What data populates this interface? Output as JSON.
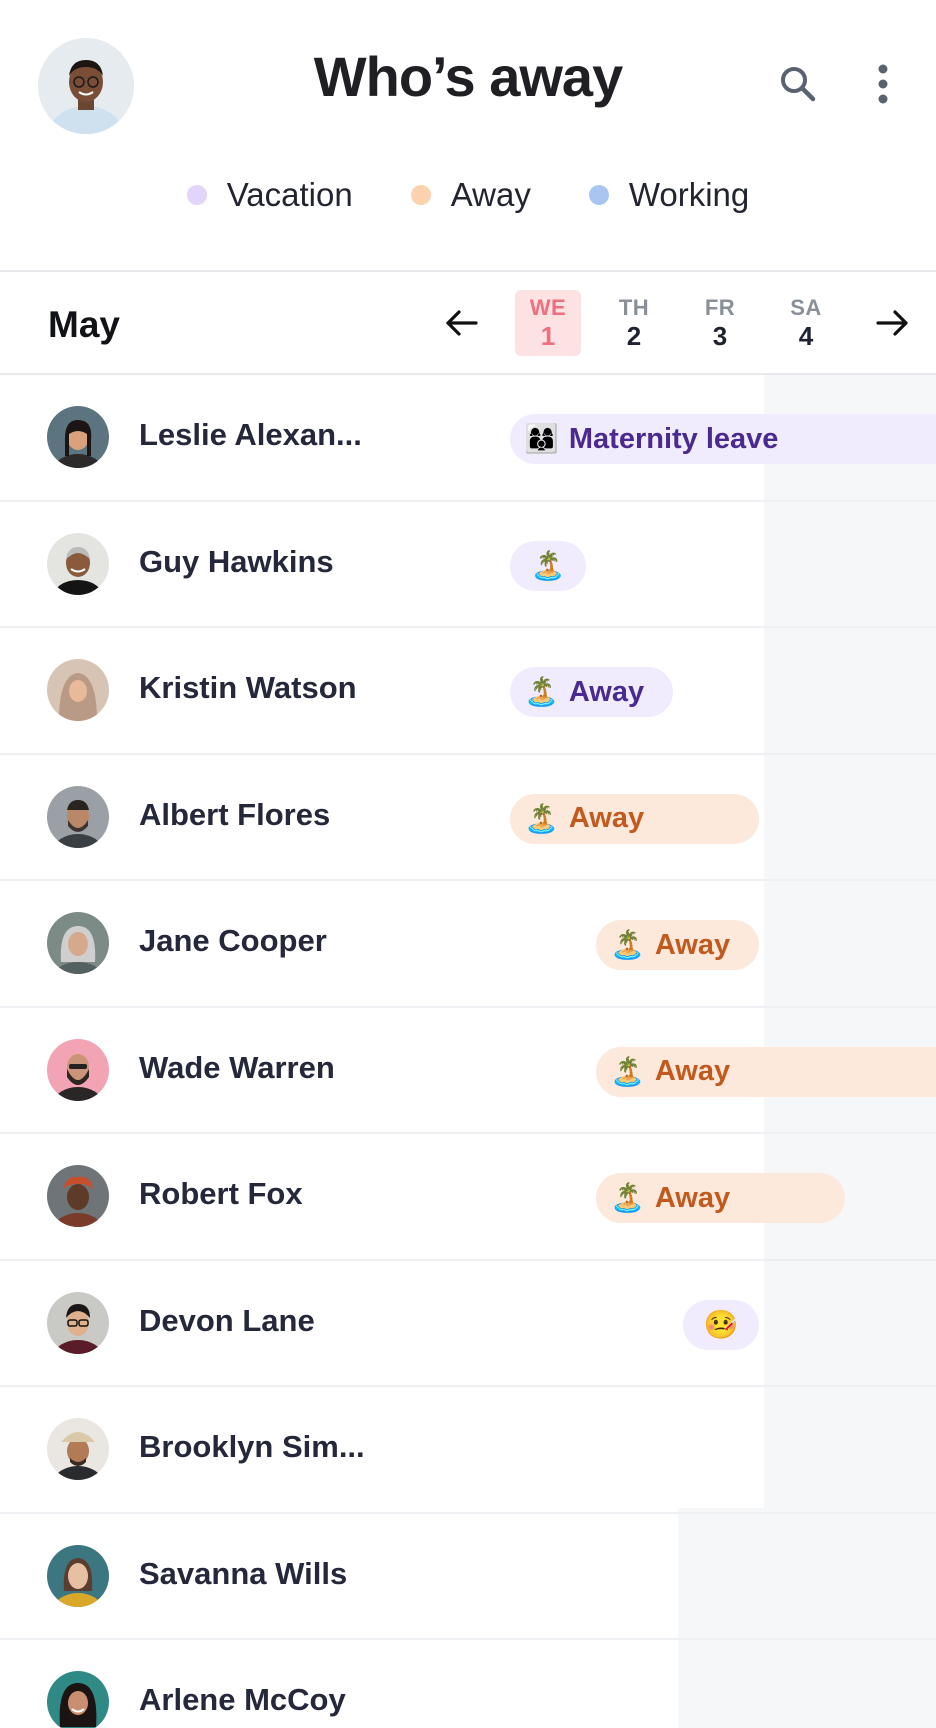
{
  "header": {
    "title": "Who’s away",
    "profile_avatar_icon": "profile-photo",
    "search_icon": "search-icon",
    "more_icon": "more-vertical-icon"
  },
  "legend": [
    {
      "label": "Vacation",
      "color": "#e3d4fb"
    },
    {
      "label": "Away",
      "color": "#fbd2ae"
    },
    {
      "label": "Working",
      "color": "#a9c6f3"
    }
  ],
  "calendar": {
    "month": "May",
    "prev_icon": "arrow-left-icon",
    "next_icon": "arrow-right-icon",
    "days": [
      {
        "name": "WE",
        "num": "1",
        "today": true
      },
      {
        "name": "TH",
        "num": "2",
        "today": false
      },
      {
        "name": "FR",
        "num": "3",
        "today": false
      },
      {
        "name": "SA",
        "num": "4",
        "today": false
      }
    ]
  },
  "rows": [
    {
      "name": "Leslie Alexan...",
      "status": {
        "type": "vacation",
        "emoji": "👩‍👩‍👦",
        "label": "Maternity leave"
      }
    },
    {
      "name": "Guy Hawkins",
      "status": {
        "type": "vacation",
        "emoji": "🏝️",
        "label": ""
      }
    },
    {
      "name": "Kristin Watson",
      "status": {
        "type": "vacation",
        "emoji": "🏝️",
        "label": "Away"
      }
    },
    {
      "name": "Albert Flores",
      "status": {
        "type": "away",
        "emoji": "🏝️",
        "label": "Away"
      }
    },
    {
      "name": "Jane Cooper",
      "status": {
        "type": "away",
        "emoji": "🏝️",
        "label": "Away"
      }
    },
    {
      "name": "Wade Warren",
      "status": {
        "type": "away",
        "emoji": "🏝️",
        "label": "Away"
      }
    },
    {
      "name": "Robert Fox",
      "status": {
        "type": "away",
        "emoji": "🏝️",
        "label": "Away"
      }
    },
    {
      "name": "Devon Lane",
      "status": {
        "type": "vacation",
        "emoji": "🤒",
        "label": ""
      }
    },
    {
      "name": "Brooklyn Sim...",
      "status": null
    },
    {
      "name": "Savanna Wills",
      "status": null
    },
    {
      "name": "Arlene McCoy",
      "status": null
    }
  ],
  "colors": {
    "today_bg": "#fde2e4",
    "today_text": "#ef6f7e",
    "vacation_pill": "#f1ecfd",
    "vacation_text": "#4b2a8f",
    "away_pill": "#fce9dc",
    "away_text": "#c2591d"
  }
}
